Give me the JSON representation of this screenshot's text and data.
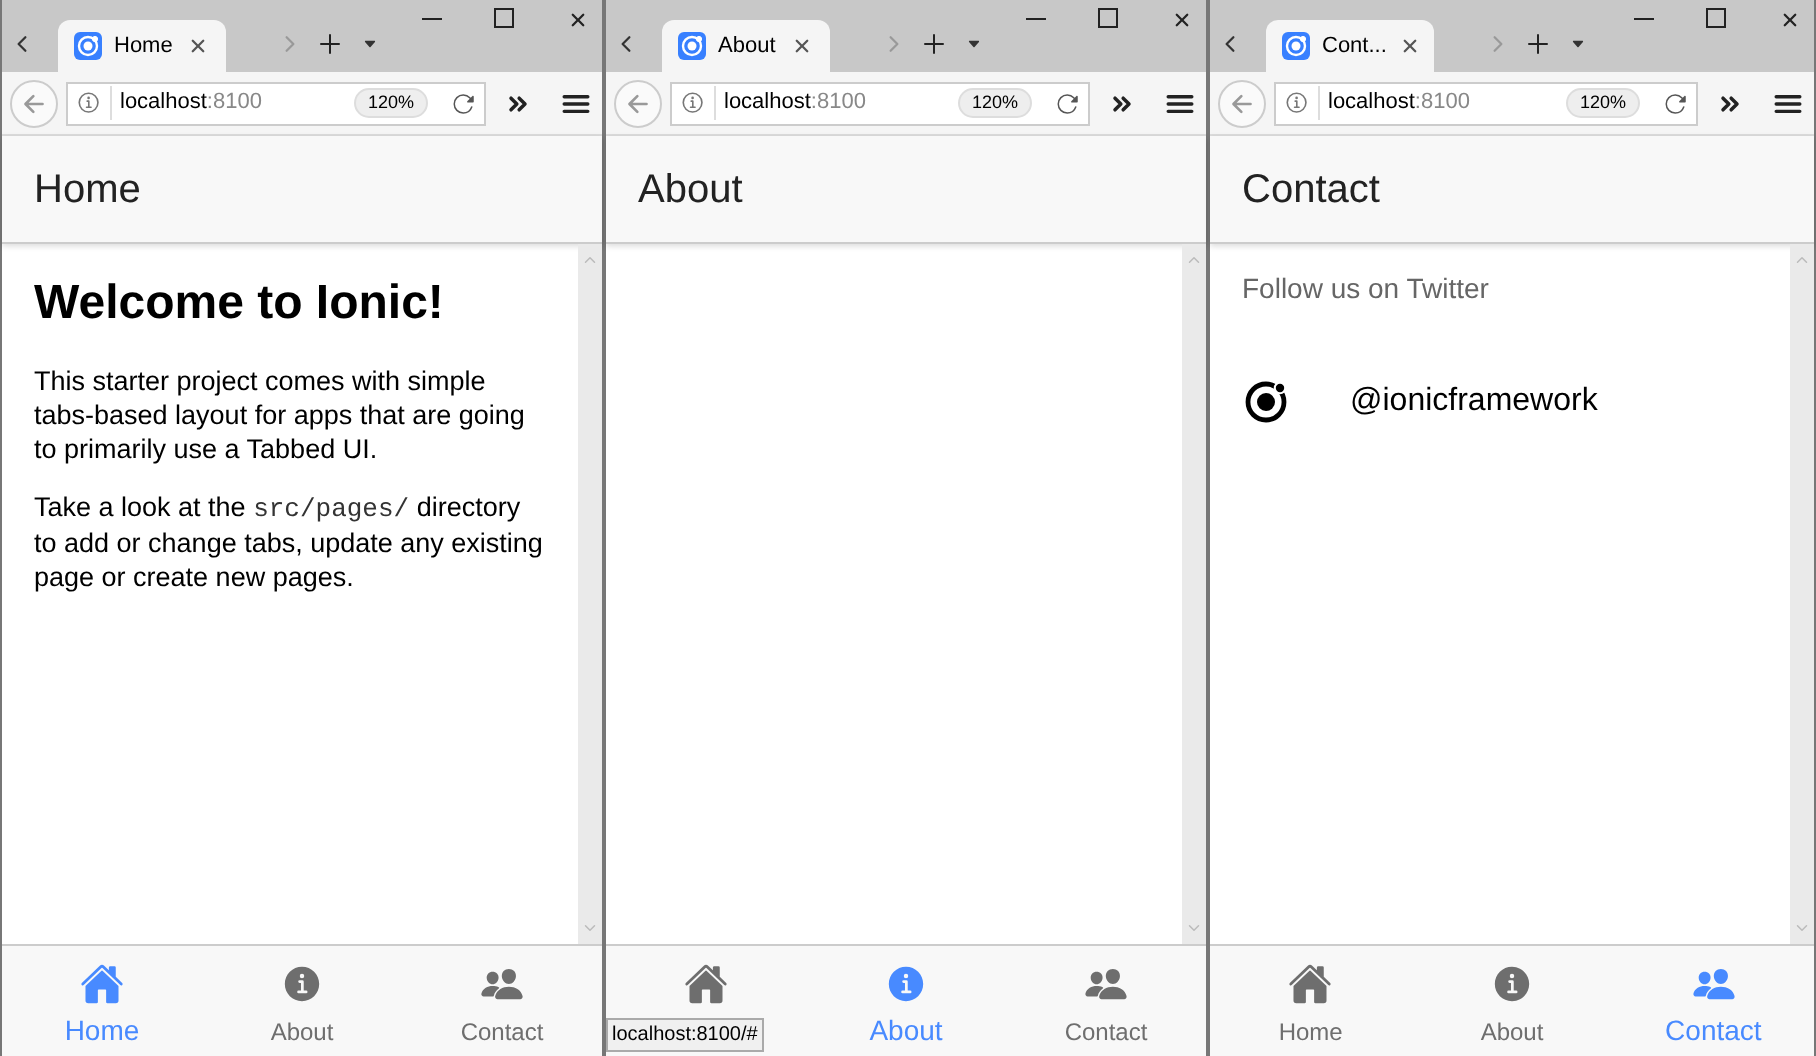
{
  "windows": [
    {
      "browser_tab": "Home",
      "url_host": "localhost",
      "url_port": ":8100",
      "zoom": "120%",
      "title": "Home",
      "content": {
        "kind": "home",
        "heading": "Welcome to Ionic!",
        "paragraphs": [
          [
            {
              "kind": "text",
              "text": "This starter project comes with simple tabs-based layout for apps that are going to primarily use a Tabbed UI."
            }
          ],
          [
            {
              "kind": "text",
              "text": "Take a look at the "
            },
            {
              "kind": "code",
              "text": "src/pages/"
            },
            {
              "kind": "text",
              "text": " directory to add or change tabs, update any existing page or create new pages."
            }
          ]
        ]
      },
      "tabs": [
        {
          "kind": "home",
          "label": "Home",
          "selected": true
        },
        {
          "kind": "info",
          "label": "About",
          "selected": false
        },
        {
          "kind": "people",
          "label": "Contact",
          "selected": false
        }
      ]
    },
    {
      "browser_tab": "About",
      "url_host": "localhost",
      "url_port": ":8100",
      "zoom": "120%",
      "title": "About",
      "content": {
        "kind": "empty"
      },
      "status_tooltip": "localhost:8100/#",
      "tabs": [
        {
          "kind": "home",
          "selected": false
        },
        {
          "kind": "info",
          "label": "About",
          "selected": true
        },
        {
          "kind": "people",
          "label": "Contact",
          "selected": false
        }
      ]
    },
    {
      "browser_tab": "Cont...",
      "url_host": "localhost",
      "url_port": ":8100",
      "zoom": "120%",
      "title": "Contact",
      "content": {
        "kind": "contact",
        "list_header": "Follow us on Twitter",
        "item": "@ionicframework"
      },
      "tabs": [
        {
          "kind": "home",
          "label": "Home",
          "selected": false
        },
        {
          "kind": "info",
          "label": "About",
          "selected": false
        },
        {
          "kind": "people",
          "label": "Contact",
          "selected": true
        }
      ]
    }
  ]
}
